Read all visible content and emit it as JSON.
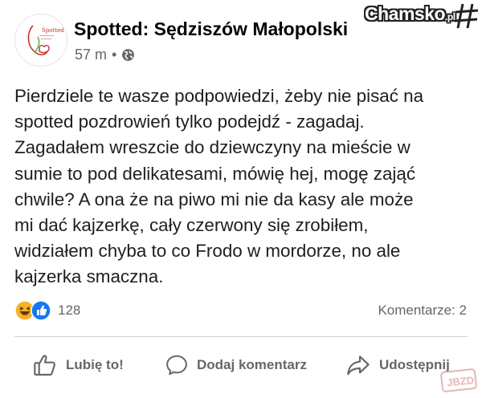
{
  "post": {
    "page_name": "Spotted: Sędziszów Małopolski",
    "avatar_text": "Spotted",
    "time": "57 m",
    "separator": "•",
    "privacy_icon": "globe-icon",
    "text": "Pierdziele te wasze podpowiedzi, żeby nie pisać na\nspotted pozdrowień tylko podejdź - zagadaj.\nZagadałem wreszcie do dziewczyny na mieście w\nsumie to pod delikatesami, mówię hej, mogę zająć\nchwile? A ona że na piwo mi nie da kasy ale może\nmi dać kajzerkę, cały czerwony się zrobiłem,\nwidziałem chyba to co Frodo w mordorze, no ale\nkajzerka smaczna."
  },
  "reactions": {
    "icons": [
      "haha-icon",
      "like-icon"
    ],
    "count": "128"
  },
  "comments": {
    "label": "Komentarze: 2"
  },
  "actions": {
    "like_label": "Lubię to!",
    "comment_label": "Dodaj komentarz",
    "share_label": "Udostępnij"
  },
  "watermark": {
    "text": "Chamsko",
    "suffix": ".pl",
    "bottom_text": "JBZD"
  },
  "colors": {
    "text": "#1c1e21",
    "secondary": "#65676b",
    "like_blue": "#1877f2",
    "haha_yellow": "#f7b125"
  }
}
